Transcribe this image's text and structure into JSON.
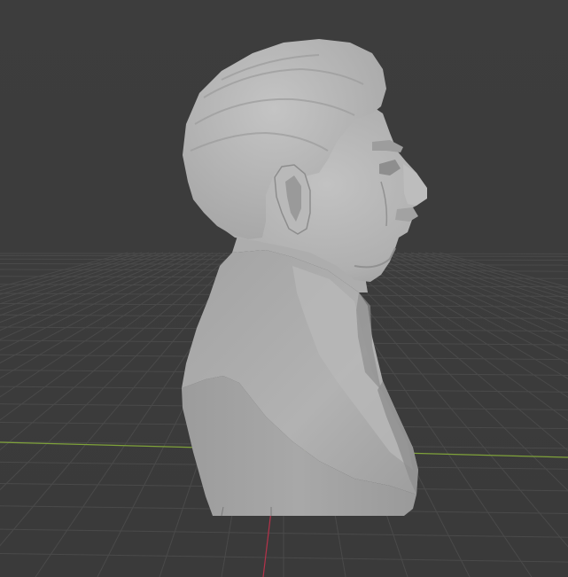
{
  "viewport": {
    "background_color": "#3d3d3d",
    "grid_color": "#4a4a4a",
    "x_axis_color": "#7fa23a",
    "y_axis_color": "#b5324a",
    "mesh_color": "#a9a9a9",
    "object": "bust-mesh"
  }
}
